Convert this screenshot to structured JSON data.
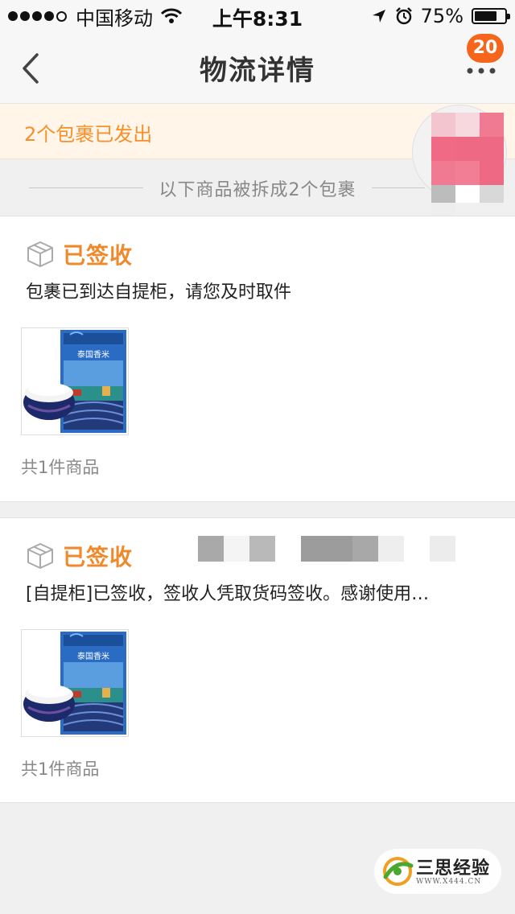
{
  "status_bar": {
    "carrier": "中国移动",
    "time": "上午8:31",
    "battery_percent": "75%",
    "battery_level": 0.75,
    "signal_bars": 4
  },
  "nav": {
    "title": "物流详情",
    "more_badge": "20"
  },
  "notice": {
    "text": "2个包裹已发出"
  },
  "divider": {
    "text": "以下商品被拆成2个包裹"
  },
  "packages": [
    {
      "status": "已签收",
      "description": "包裹已到达自提柜，请您及时取件",
      "count_label": "共1件商品"
    },
    {
      "status": "已签收",
      "description": "[自提柜]已签收，签收人凭取货码签收。感谢使用…",
      "count_label": "共1件商品"
    }
  ],
  "product_image": {
    "bag_text": "泰国香米"
  },
  "watermark": {
    "title": "三思经验",
    "url": "WWW.X444.CN"
  },
  "colors": {
    "accent_orange": "#ee8a2c",
    "badge_orange": "#f5651b",
    "notice_bg": "#fff5e8",
    "page_bg": "#f0f0f0"
  }
}
